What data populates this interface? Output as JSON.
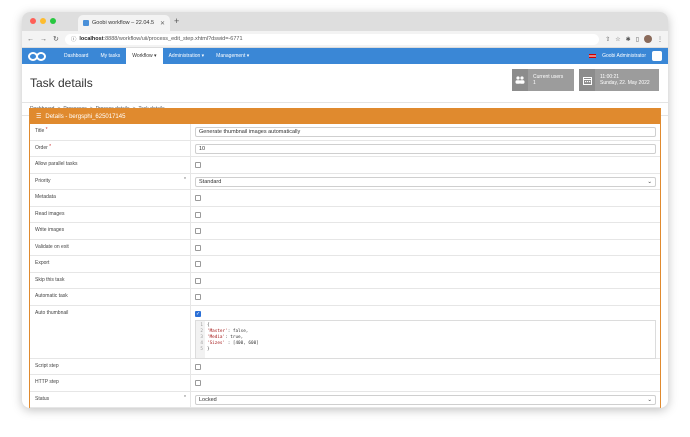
{
  "browser": {
    "tab_title": "Goobi workflow – 22.04.5",
    "url_host": "localhost",
    "url_path": ":8888/workflow/uii/process_edit_step.xhtml?dswid=-6771"
  },
  "nav": {
    "items": [
      "Dashboard",
      "My tasks",
      "Workflow",
      "Administration",
      "Management"
    ],
    "user": "Goobi Administrator"
  },
  "header": {
    "title": "Task details",
    "current_users_label": "Current users",
    "current_users_count": "1",
    "time": "11:00:21",
    "date": "Sunday, 22. May 2022"
  },
  "breadcrumb": [
    "Dashboard",
    "Processes",
    "Process details",
    "Task details"
  ],
  "panel": {
    "title": "Details - bergsphi_625017145"
  },
  "fields": {
    "title_label": "Title",
    "title_value": "Generate thumbnail images automatically",
    "order_label": "Order",
    "order_value": "10",
    "parallel_label": "Allow parallel tasks",
    "priority_label": "Priority",
    "priority_value": "Standard",
    "metadata_label": "Metadata",
    "read_images_label": "Read images",
    "write_images_label": "Write images",
    "validate_label": "Validate on exit",
    "export_label": "Export",
    "skip_label": "Skip this task",
    "automatic_label": "Automatic task",
    "auto_thumb_label": "Auto thumbnail",
    "script_label": "Script step",
    "http_label": "HTTP step",
    "status_label": "Status",
    "status_value": "Locked"
  },
  "code": {
    "lines": [
      "1",
      "2",
      "3",
      "4",
      "5"
    ],
    "brace_open": "{",
    "master_key": "'Master'",
    "master_val": ": false,",
    "media_key": "'Media'",
    "media_val": ": true,",
    "sizes_key": "'Sizes'",
    "sizes_val": " : [400, 600]",
    "brace_close": "}"
  }
}
